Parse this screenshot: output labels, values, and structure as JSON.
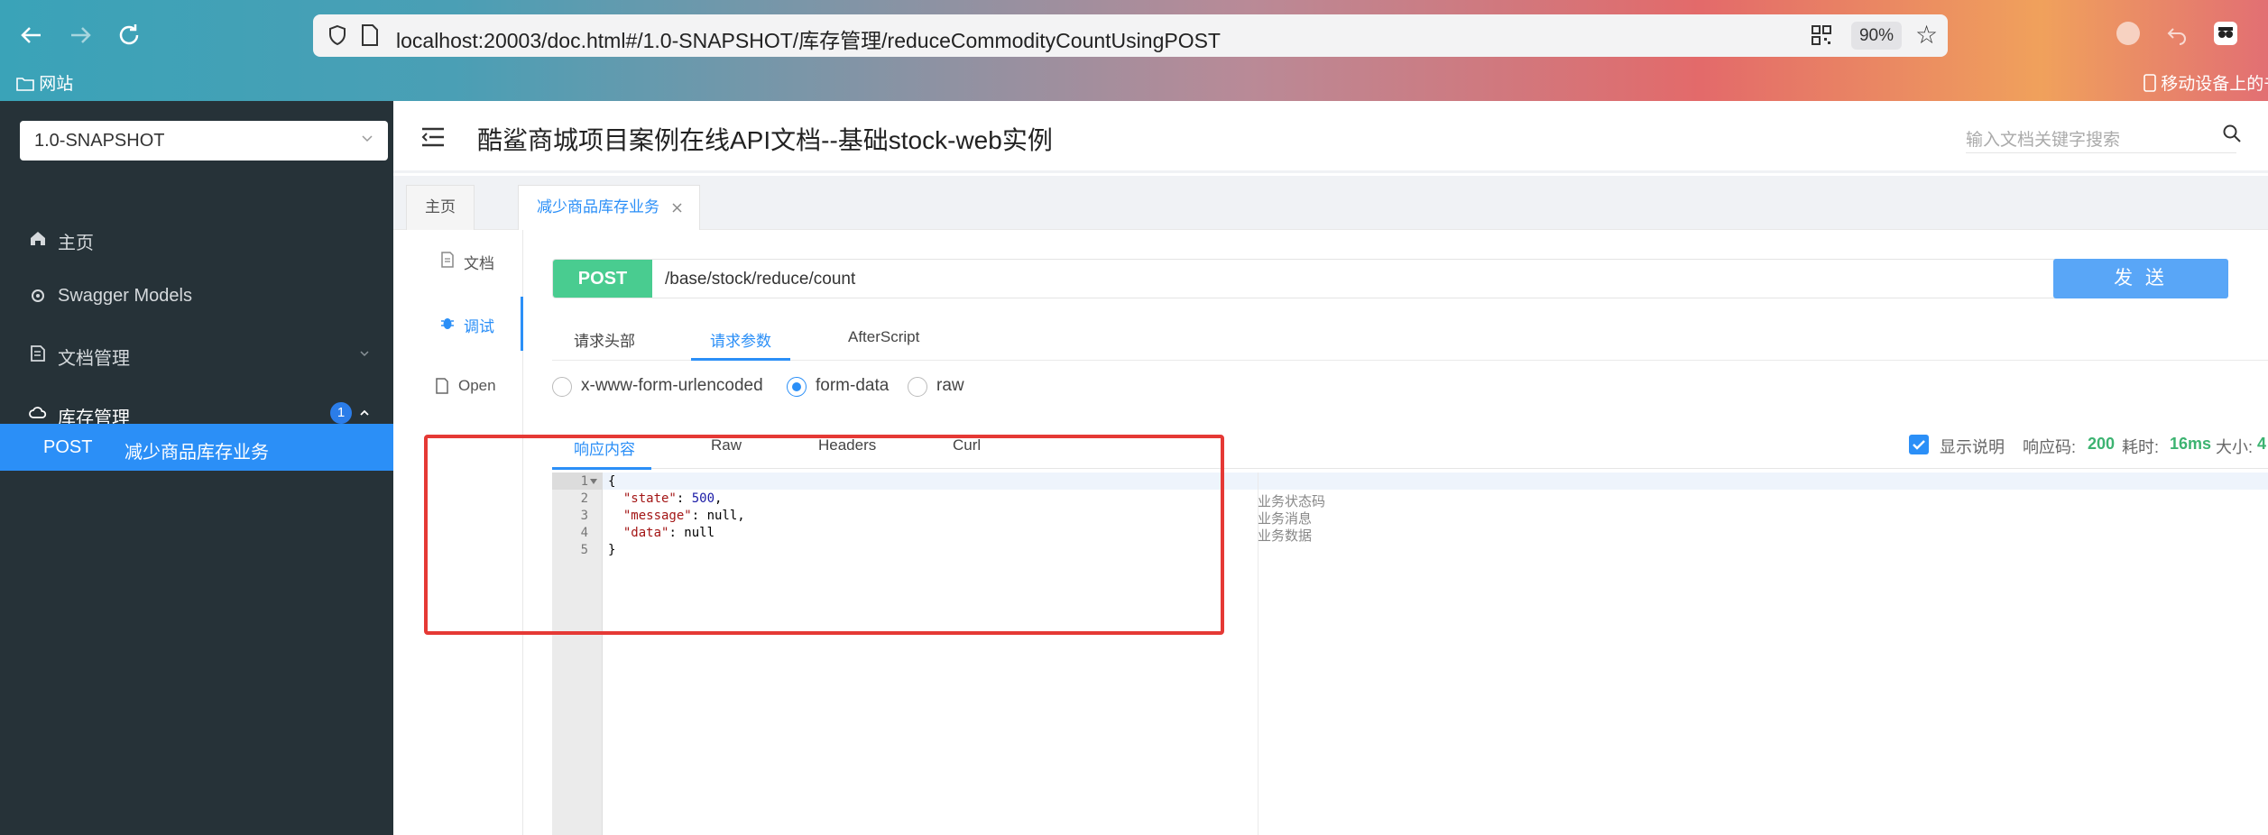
{
  "browser": {
    "url": "localhost:20003/doc.html#/1.0-SNAPSHOT/库存管理/reduceCommodityCountUsingPOST",
    "zoom": "90%",
    "bookmark_folder": "网站",
    "bookmark_right": "移动设备上的书签"
  },
  "sidebar": {
    "version": "1.0-SNAPSHOT",
    "items": [
      {
        "label": "主页",
        "icon": "home-icon"
      },
      {
        "label": "Swagger Models",
        "icon": "gear-icon"
      },
      {
        "label": "文档管理",
        "icon": "doc-manage-icon"
      },
      {
        "label": "库存管理",
        "icon": "cloud-icon",
        "badge": "1"
      }
    ],
    "active_item": {
      "method": "POST",
      "label": "减少商品库存业务"
    }
  },
  "header": {
    "title": "酷鲨商城项目案例在线API文档--基础stock-web实例",
    "search_placeholder": "输入文档关键字搜索"
  },
  "tabs": {
    "home": "主页",
    "active": "减少商品库存业务"
  },
  "subnav": {
    "doc": "文档",
    "debug": "调试",
    "open": "Open"
  },
  "request": {
    "method": "POST",
    "path": "/base/stock/reduce/count",
    "send_label": "发 送",
    "tabs": [
      "请求头部",
      "请求参数",
      "AfterScript"
    ],
    "active_tab": "请求参数",
    "content_types": [
      "x-www-form-urlencoded",
      "form-data",
      "raw"
    ],
    "selected_content_type": "form-data"
  },
  "response": {
    "tabs": [
      "响应内容",
      "Raw",
      "Headers",
      "Curl"
    ],
    "active_tab": "响应内容",
    "show_desc_label": "显示说明",
    "code_label": "响应码:",
    "code": "200",
    "time_label": "耗时:",
    "time": "16ms",
    "size_label": "大小:",
    "size": "4",
    "lines": [
      "1",
      "2",
      "3",
      "4",
      "5"
    ],
    "body": {
      "open": "{",
      "l2_key": "\"state\"",
      "l2_val": "500",
      "l3_key": "\"message\"",
      "l3_val": "null",
      "l4_key": "\"data\"",
      "l4_val": "null",
      "close": "}"
    },
    "descriptions": [
      "业务状态码",
      "业务消息",
      "业务数据"
    ]
  },
  "colors": {
    "sidebar_bg": "#263238",
    "accent": "#2b8ff7",
    "post_green": "#49cc90",
    "highlight_red": "#e53935"
  }
}
